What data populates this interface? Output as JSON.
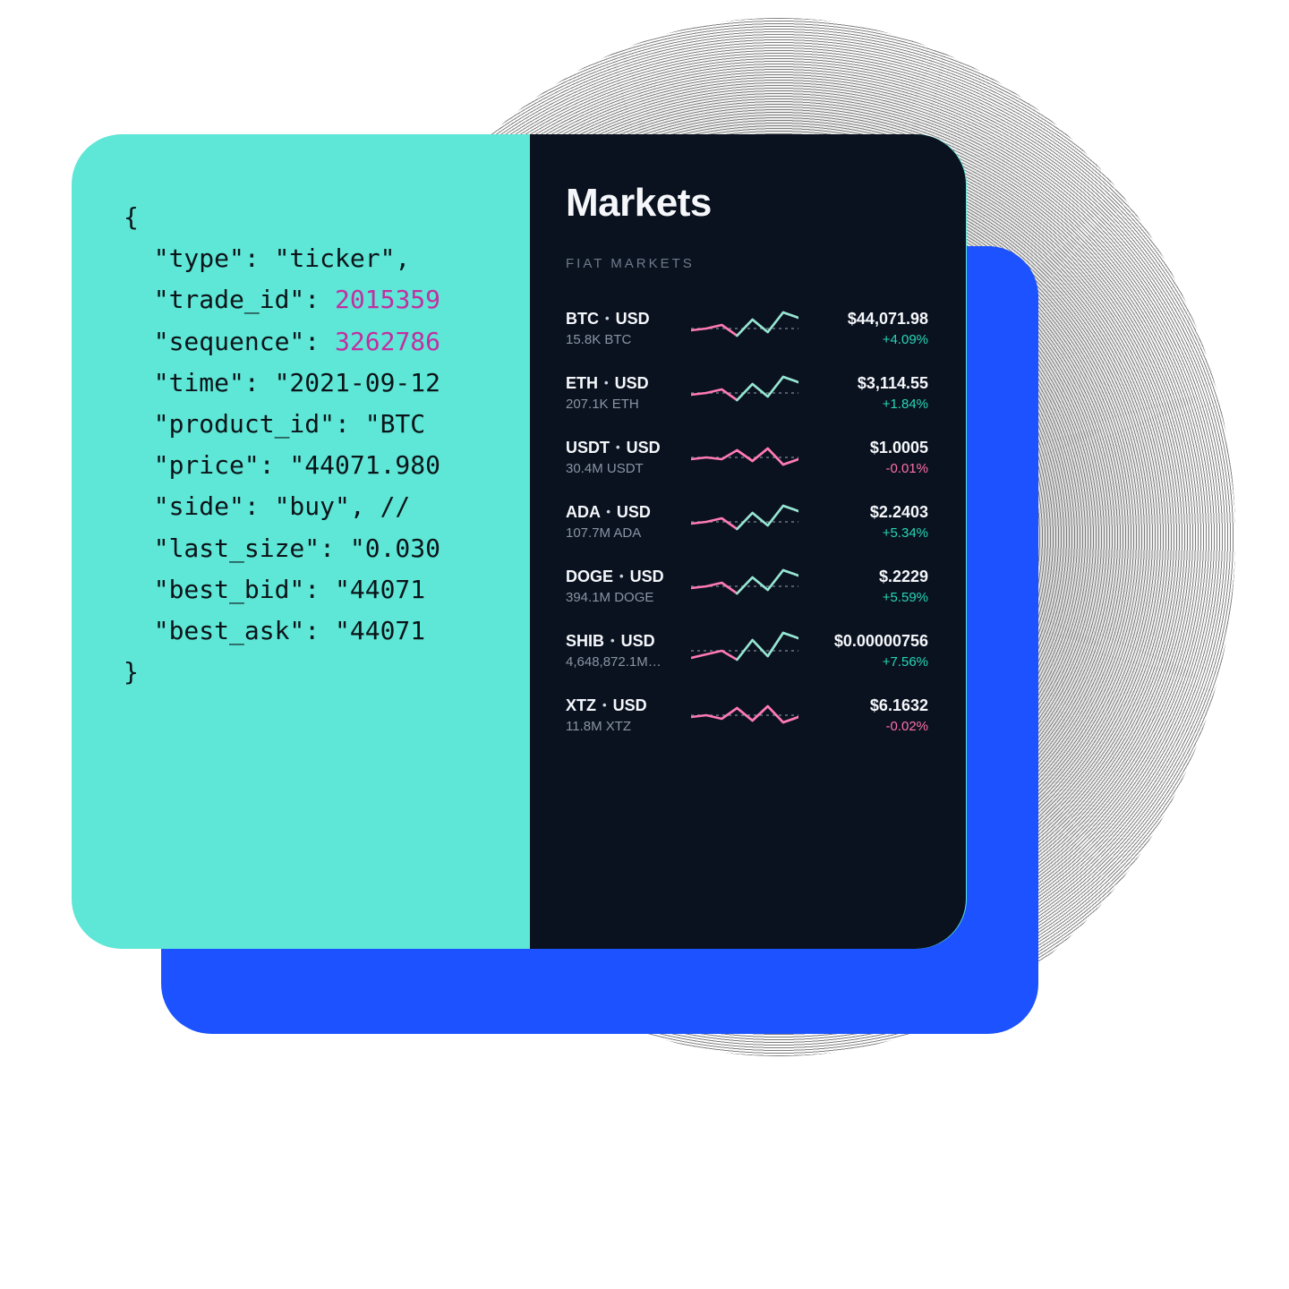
{
  "code": {
    "lines": [
      {
        "t": "{"
      },
      {
        "t": "  \"type\": \"ticker\","
      },
      {
        "t": "  \"trade_id\": ",
        "num": "2015359"
      },
      {
        "t": "  \"sequence\": ",
        "num": "3262786"
      },
      {
        "t": "  \"time\": \"2021-09-12"
      },
      {
        "t": "  \"product_id\": \"BTC"
      },
      {
        "t": "  \"price\": \"44071.980"
      },
      {
        "t": "  \"side\": \"buy\", // "
      },
      {
        "t": "  \"last_size\": \"0.030"
      },
      {
        "t": "  \"best_bid\": \"44071"
      },
      {
        "t": "  \"best_ask\": \"44071"
      },
      {
        "t": "}"
      }
    ]
  },
  "markets": {
    "title": "Markets",
    "section": "FIAT MARKETS",
    "items": [
      {
        "base": "BTC",
        "quote": "USD",
        "vol": "15.8K BTC",
        "price": "$44,071.98",
        "chg": "+4.09%",
        "up": true
      },
      {
        "base": "ETH",
        "quote": "USD",
        "vol": "207.1K ETH",
        "price": "$3,114.55",
        "chg": "+1.84%",
        "up": true
      },
      {
        "base": "USDT",
        "quote": "USD",
        "vol": "30.4M USDT",
        "price": "$1.0005",
        "chg": "-0.01%",
        "up": false
      },
      {
        "base": "ADA",
        "quote": "USD",
        "vol": "107.7M ADA",
        "price": "$2.2403",
        "chg": "+5.34%",
        "up": true
      },
      {
        "base": "DOGE",
        "quote": "USD",
        "vol": "394.1M DOGE",
        "price": "$.2229",
        "chg": "+5.59%",
        "up": true
      },
      {
        "base": "SHIB",
        "quote": "USD",
        "vol": "4,648,872.1M…",
        "price": "$0.00000756",
        "chg": "+7.56%",
        "up": true
      },
      {
        "base": "XTZ",
        "quote": "USD",
        "vol": "11.8M XTZ",
        "price": "$6.1632",
        "chg": "-0.02%",
        "up": false
      }
    ]
  },
  "chart_data": [
    {
      "type": "line",
      "title": "BTC·USD sparkline",
      "x": [
        0,
        1,
        2,
        3,
        4,
        5,
        6,
        7
      ],
      "values": [
        20,
        22,
        26,
        14,
        32,
        18,
        40,
        34
      ],
      "ylim": [
        0,
        44
      ]
    },
    {
      "type": "line",
      "title": "ETH·USD sparkline",
      "x": [
        0,
        1,
        2,
        3,
        4,
        5,
        6,
        7
      ],
      "values": [
        20,
        22,
        26,
        14,
        32,
        18,
        40,
        34
      ],
      "ylim": [
        0,
        44
      ]
    },
    {
      "type": "line",
      "title": "USDT·USD sparkline",
      "x": [
        0,
        1,
        2,
        3,
        4,
        5,
        6,
        7
      ],
      "values": [
        20,
        22,
        20,
        30,
        18,
        32,
        14,
        20
      ],
      "ylim": [
        0,
        44
      ]
    },
    {
      "type": "line",
      "title": "ADA·USD sparkline",
      "x": [
        0,
        1,
        2,
        3,
        4,
        5,
        6,
        7
      ],
      "values": [
        20,
        22,
        26,
        14,
        32,
        18,
        40,
        34
      ],
      "ylim": [
        0,
        44
      ]
    },
    {
      "type": "line",
      "title": "DOGE·USD sparkline",
      "x": [
        0,
        1,
        2,
        3,
        4,
        5,
        6,
        7
      ],
      "values": [
        20,
        22,
        26,
        14,
        32,
        18,
        40,
        34
      ],
      "ylim": [
        0,
        44
      ]
    },
    {
      "type": "line",
      "title": "SHIB·USD sparkline",
      "x": [
        0,
        1,
        2,
        3,
        4,
        5,
        6,
        7
      ],
      "values": [
        14,
        18,
        22,
        12,
        34,
        16,
        42,
        36
      ],
      "ylim": [
        0,
        44
      ]
    },
    {
      "type": "line",
      "title": "XTZ·USD sparkline",
      "x": [
        0,
        1,
        2,
        3,
        4,
        5,
        6,
        7
      ],
      "values": [
        20,
        22,
        18,
        30,
        16,
        32,
        14,
        20
      ],
      "ylim": [
        0,
        44
      ]
    }
  ]
}
